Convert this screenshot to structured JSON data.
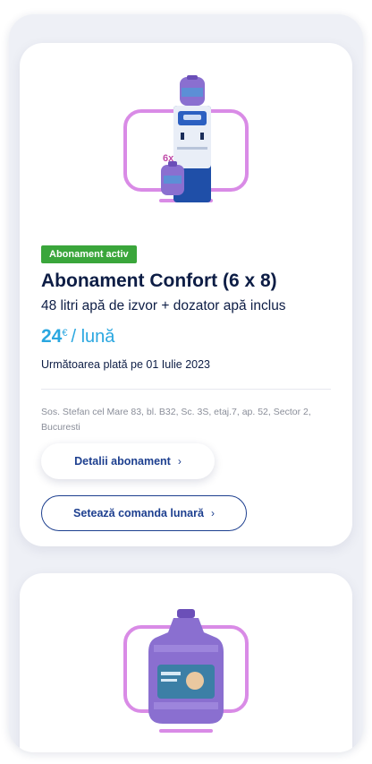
{
  "subscription_card": {
    "badge": "Abonament activ",
    "title": "Abonament Confort (6 x 8)",
    "description": "48 litri apă de izvor + dozator apă inclus",
    "price": {
      "amount": "24",
      "currency": "€",
      "period": "/ lună"
    },
    "next_payment": "Următoarea plată pe 01 Iulie 2023",
    "address": "Sos. Stefan cel Mare 83, bl. B32, Sc. 3S, etaj.7, ap. 52, Sector 2, Bucuresti",
    "details_button": "Detalii abonament",
    "monthly_order_button": "Setează comanda lunară",
    "bundle_quantity_label": "6x"
  },
  "colors": {
    "badge_green": "#3aa63b",
    "title_navy": "#0d1d45",
    "price_blue": "#2aa7e0",
    "button_blue": "#1d3f8f",
    "frame_pink": "#d98be6",
    "bottle_purple": "#8a6fd0"
  },
  "icons": {
    "button_chevron": "chevron-right-icon"
  }
}
